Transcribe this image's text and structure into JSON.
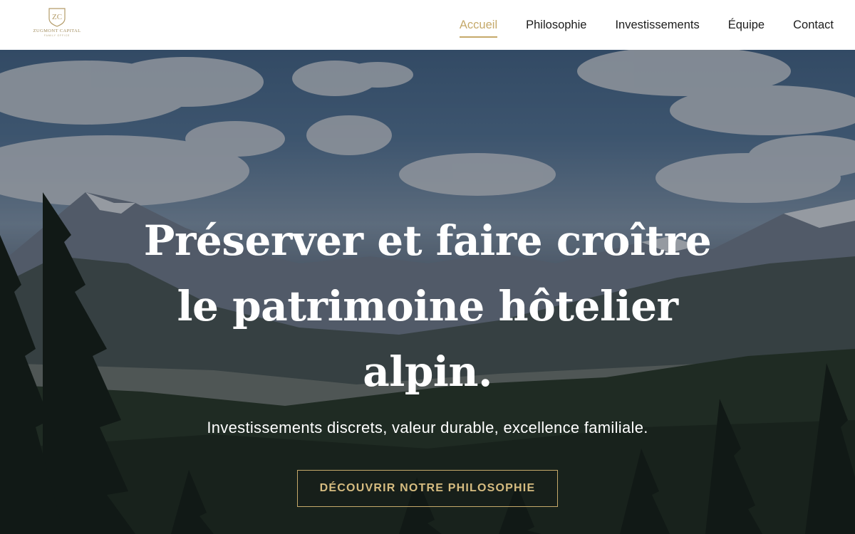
{
  "brand": {
    "monogram": "ZC",
    "name": "ZUGMONT CAPITAL",
    "tagline": "FAMILY OFFICE",
    "accent_color": "#c5a96a"
  },
  "nav": {
    "items": [
      {
        "label": "Accueil",
        "active": true
      },
      {
        "label": "Philosophie",
        "active": false
      },
      {
        "label": "Investissements",
        "active": false
      },
      {
        "label": "Équipe",
        "active": false
      },
      {
        "label": "Contact",
        "active": false
      }
    ]
  },
  "hero": {
    "title": "Préserver et faire croître le patrimoine hôtelier alpin.",
    "subtitle": "Investissements discrets, valeur durable, excellence familiale.",
    "cta_label": "DÉCOUVRIR NOTRE PHILOSOPHIE",
    "background": "alpine-mountain-landscape"
  }
}
